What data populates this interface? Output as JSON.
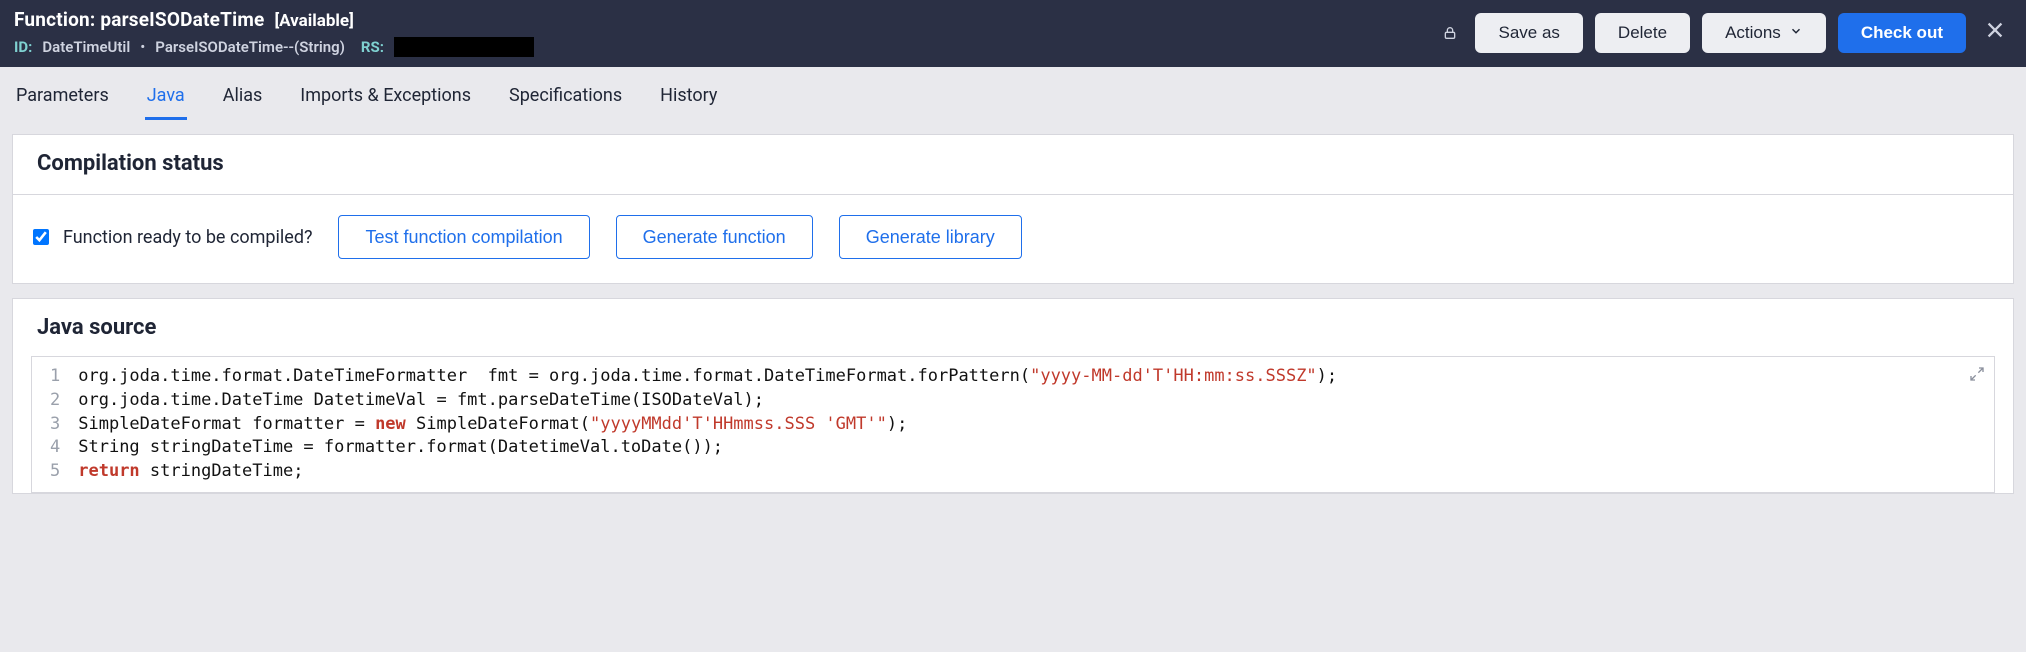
{
  "header": {
    "function_label": "Function:",
    "function_name": "parseISODateTime",
    "availability": "[Available]",
    "id_label": "ID:",
    "id_part1": "DateTimeUtil",
    "id_dot": "•",
    "id_part2": "ParseISODateTime--(String)",
    "rs_label": "RS:",
    "buttons": {
      "save_as": "Save as",
      "delete": "Delete",
      "actions": "Actions",
      "check_out": "Check out"
    }
  },
  "tabs": {
    "parameters": "Parameters",
    "java": "Java",
    "alias": "Alias",
    "imports": "Imports & Exceptions",
    "specifications": "Specifications",
    "history": "History",
    "active": "java"
  },
  "compilation": {
    "title": "Compilation status",
    "ready_label": "Function ready to be compiled?",
    "ready_checked": true,
    "test_btn": "Test function compilation",
    "generate_fn_btn": "Generate function",
    "generate_lib_btn": "Generate library"
  },
  "java_source": {
    "title": "Java source",
    "lines": [
      {
        "n": 1,
        "prefix": "org.joda.time.format.DateTimeFormatter  fmt = org.joda.time.format.DateTimeFormat.forPattern(",
        "str": "\"yyyy-MM-dd'T'HH:mm:ss.SSSZ\"",
        "suffix": ");"
      },
      {
        "n": 2,
        "plain": "org.joda.time.DateTime DatetimeVal = fmt.parseDateTime(ISODateVal);"
      },
      {
        "n": 3,
        "prefix": "SimpleDateFormat formatter = ",
        "kw": "new",
        "mid": " SimpleDateFormat(",
        "str": "\"yyyyMMdd'T'HHmmss.SSS 'GMT'\"",
        "suffix": ");"
      },
      {
        "n": 4,
        "plain": "String stringDateTime = formatter.format(DatetimeVal.toDate());"
      },
      {
        "n": 5,
        "kw": "return",
        "suffix": " stringDateTime;"
      }
    ]
  }
}
